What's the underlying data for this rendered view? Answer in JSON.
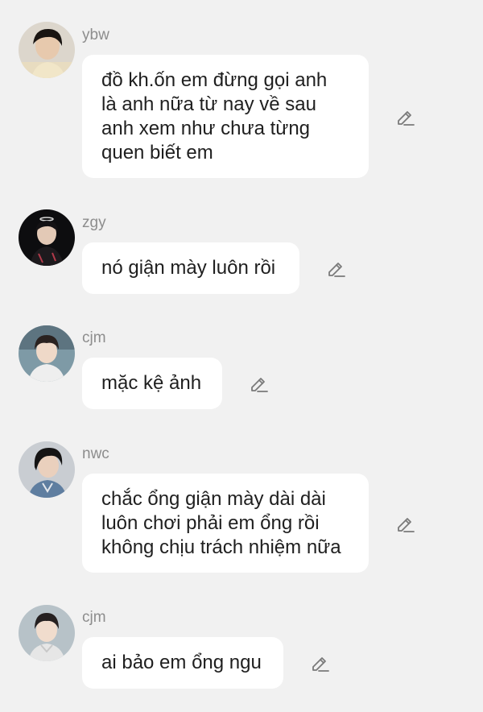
{
  "messages": [
    {
      "sender": "ybw",
      "avatar_icon": "avatar-ybw",
      "lines": [
        "đồ kh.ốn em đừng gọi anh",
        "là anh nữa từ nay về sau",
        "anh xem như chưa từng",
        "quen biết em"
      ],
      "edit_icon": "pencil-icon"
    },
    {
      "sender": "zgy",
      "avatar_icon": "avatar-zgy",
      "lines": [
        "nó giận mày luôn rồi"
      ],
      "edit_icon": "pencil-icon"
    },
    {
      "sender": "cjm",
      "avatar_icon": "avatar-cjm",
      "lines": [
        "mặc kệ ảnh"
      ],
      "edit_icon": "pencil-icon"
    },
    {
      "sender": "nwc",
      "avatar_icon": "avatar-nwc",
      "lines": [
        "chắc ổng giận mày dài dài",
        "luôn chơi phải em ổng rồi",
        "không chịu trách nhiệm nữa"
      ],
      "edit_icon": "pencil-icon"
    },
    {
      "sender": "cjm",
      "avatar_icon": "avatar-cjm",
      "lines": [
        "ai bảo em ổng ngu"
      ],
      "edit_icon": "pencil-icon"
    }
  ],
  "colors": {
    "background": "#f1f1f1",
    "bubble": "#ffffff",
    "text": "#1f1f1f",
    "sender": "#8d8d8d",
    "icon": "#7a7a7a"
  }
}
